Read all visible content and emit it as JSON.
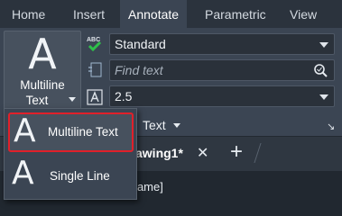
{
  "tabs": [
    {
      "label": "Home"
    },
    {
      "label": "Insert"
    },
    {
      "label": "Annotate"
    },
    {
      "label": "Parametric"
    },
    {
      "label": "View"
    }
  ],
  "ribbon": {
    "multiline_line1": "Multiline",
    "multiline_line2": "Text",
    "big_glyph": "A",
    "text_style": "Standard",
    "find_placeholder": "Find text",
    "text_height": "2.5",
    "text_panel_label": "Text",
    "abc_label": "ABC",
    "launcher": "↘"
  },
  "menu": {
    "items": [
      {
        "glyph": "A",
        "label": "Multiline Text"
      },
      {
        "glyph": "A",
        "label": "Single Line"
      }
    ]
  },
  "doc": {
    "tab_label": "awing1*",
    "close": "✕",
    "plus": "+",
    "view_label": "frame]"
  },
  "colors": {
    "accent_selected_border": "#e0202a",
    "check_green": "#2fbf4a",
    "active_tab": "#3b4553"
  }
}
